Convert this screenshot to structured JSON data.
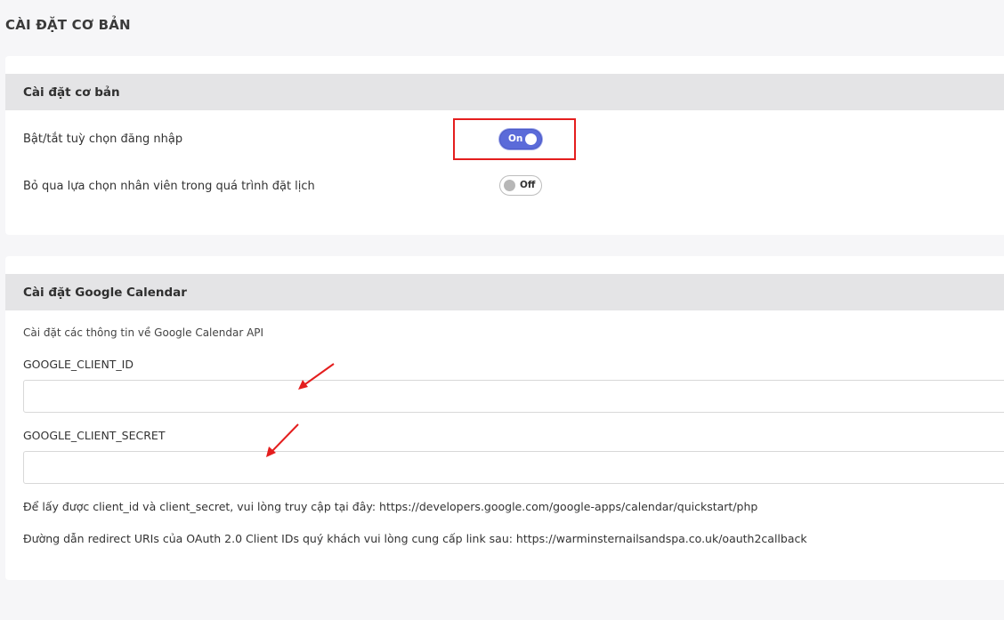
{
  "page": {
    "title": "CÀI ĐẶT CƠ BẢN"
  },
  "basic_settings": {
    "header": "Cài đặt cơ bản",
    "rows": [
      {
        "label": "Bật/tắt tuỳ chọn đăng nhập",
        "toggle_text": "On",
        "state": "on"
      },
      {
        "label": "Bỏ qua lựa chọn nhân viên trong quá trình đặt lịch",
        "toggle_text": "Off",
        "state": "off"
      }
    ]
  },
  "google_calendar": {
    "header": "Cài đặt Google Calendar",
    "description": "Cài đặt các thông tin về Google Calendar API",
    "client_id": {
      "label": "GOOGLE_CLIENT_ID",
      "value": "",
      "placeholder": ""
    },
    "client_secret": {
      "label": "GOOGLE_CLIENT_SECRET",
      "value": "",
      "placeholder": ""
    },
    "note_credentials": "Để lấy được client_id và client_secret, vui lòng truy cập tại đây: https://developers.google.com/google-apps/calendar/quickstart/php",
    "note_redirect": "Đường dẫn redirect URIs của OAuth 2.0 Client IDs quý khách vui lòng cung cấp link sau: https://warminsternailsandspa.co.uk/oauth2callback"
  },
  "colors": {
    "toggle_on": "#5b6bd9",
    "annotation": "#e41e1e",
    "header_bg": "#e4e4e6"
  }
}
